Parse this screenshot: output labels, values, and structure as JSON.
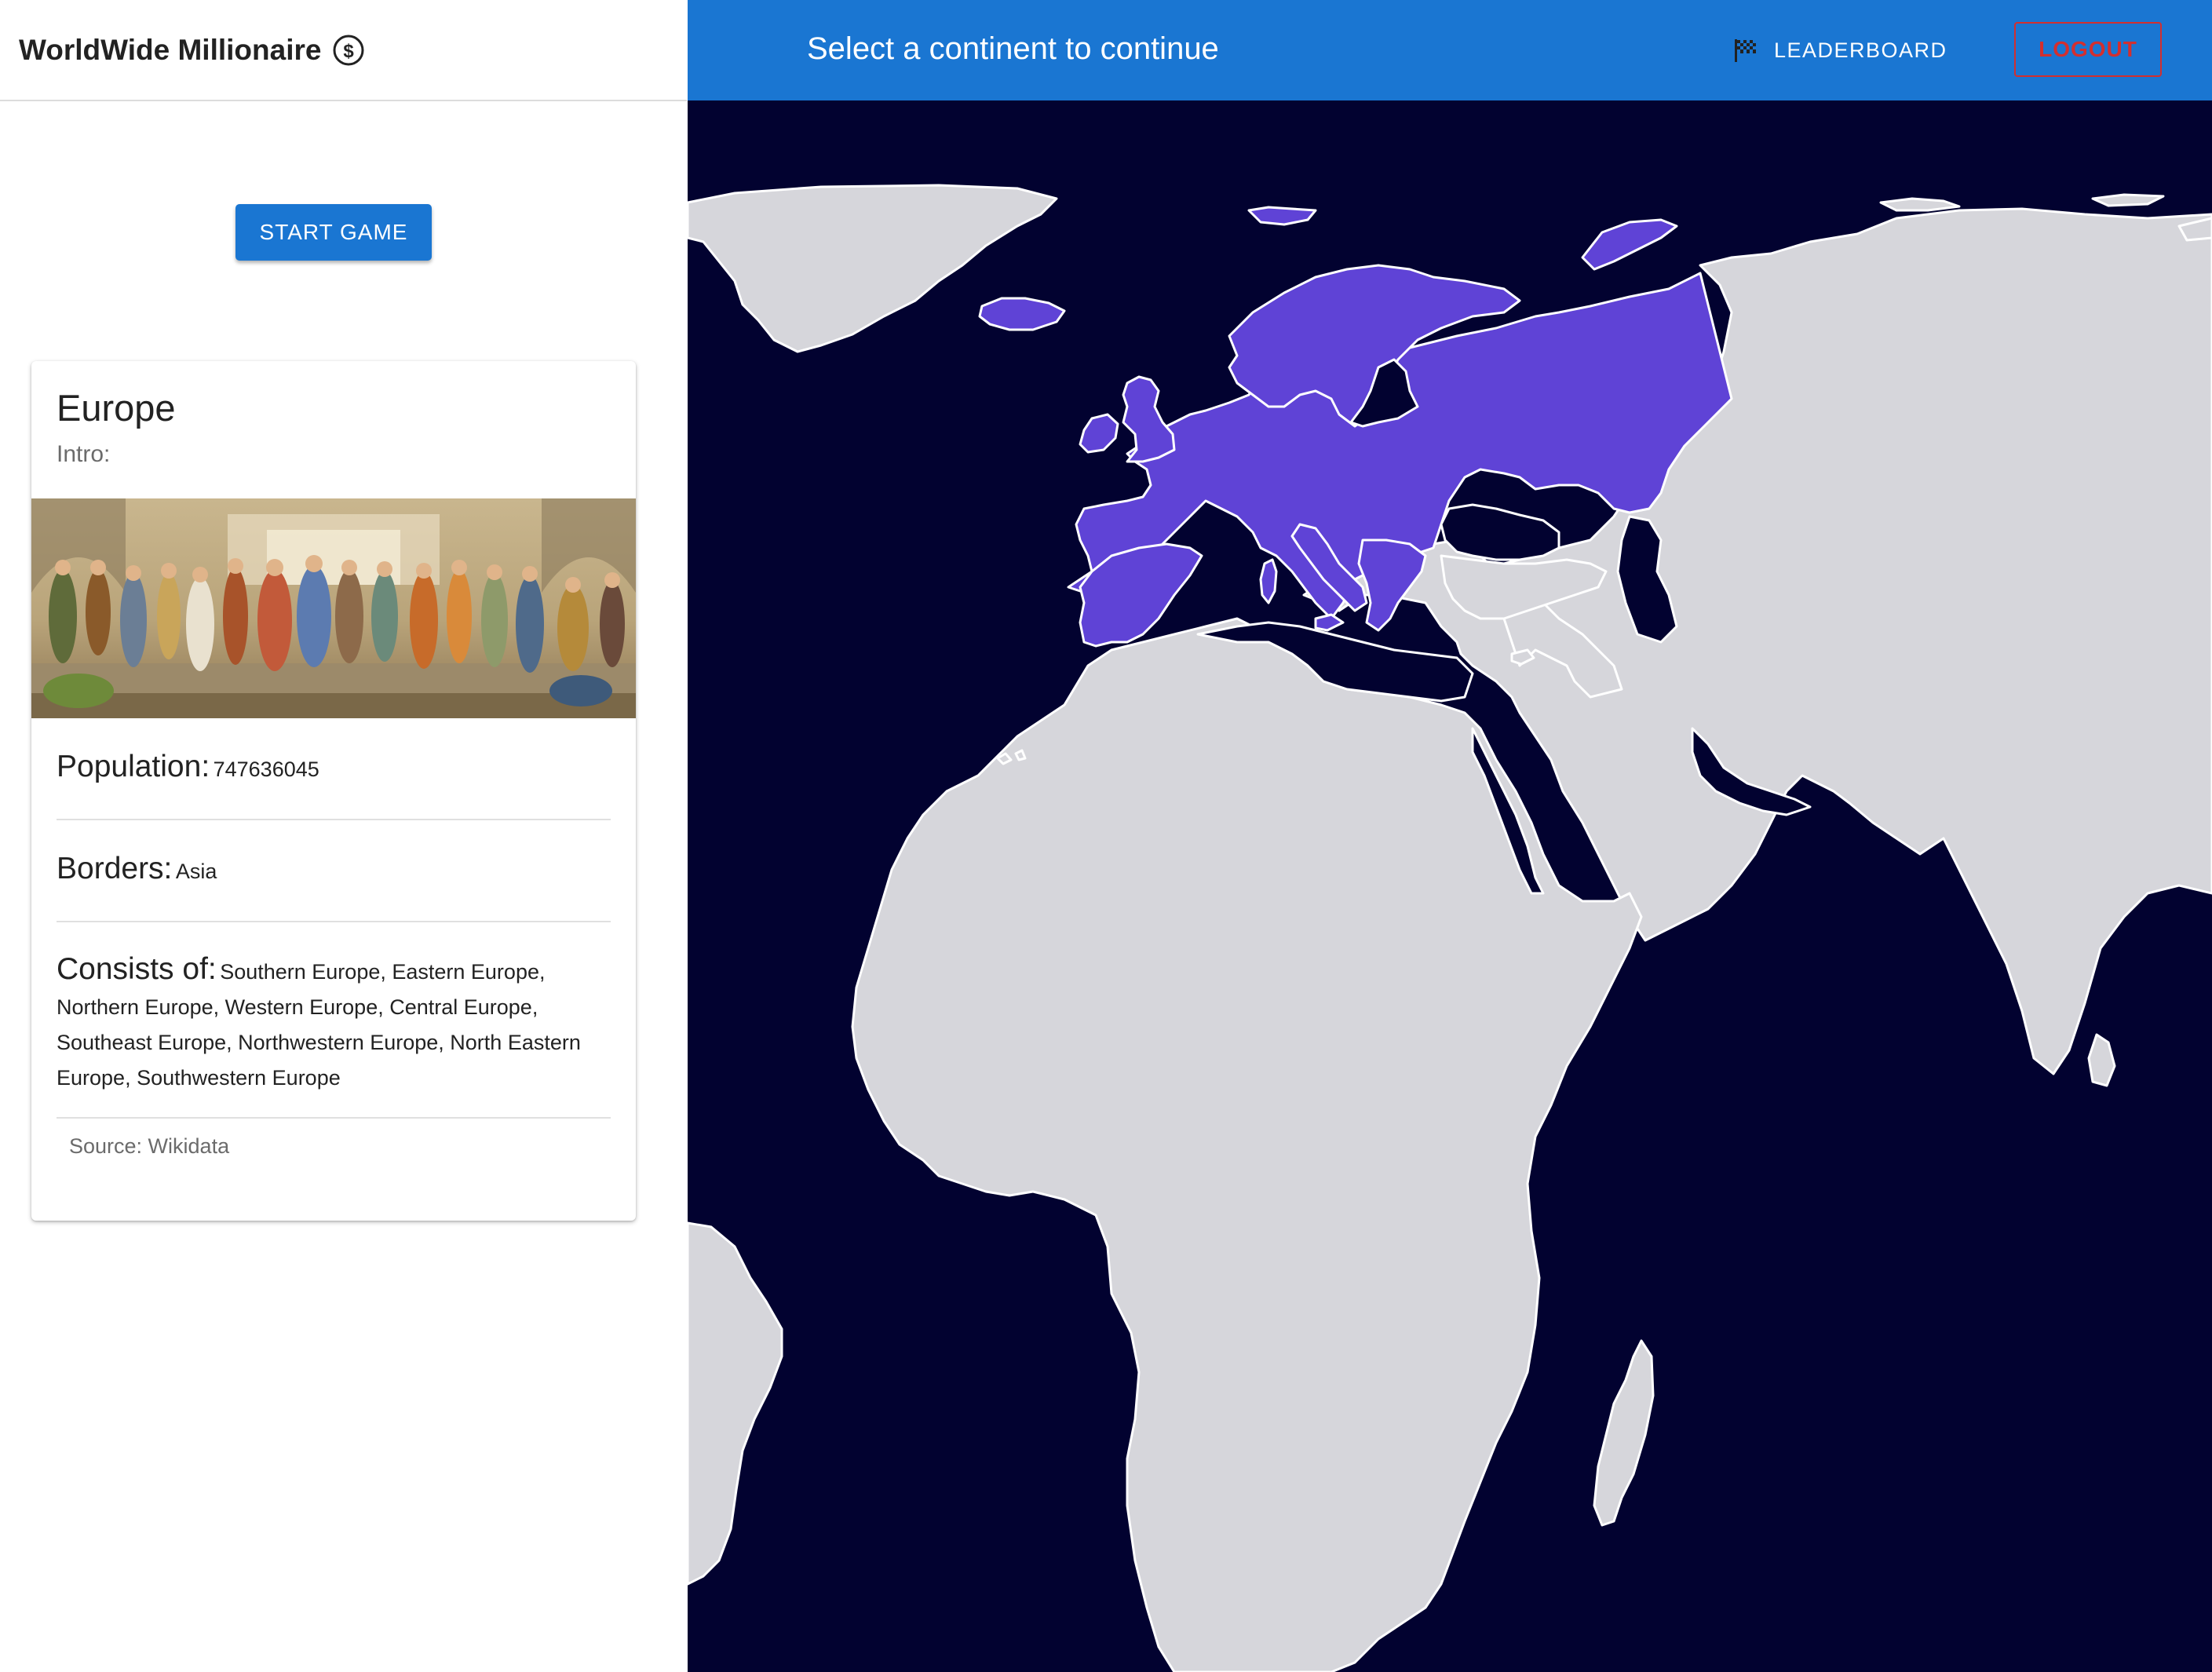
{
  "app": {
    "title": "WorldWide Millionaire",
    "title_icon": "dollar-circle-icon"
  },
  "left_panel": {
    "start_button_label": "START GAME"
  },
  "card": {
    "title": "Europe",
    "intro_label": "Intro:",
    "image_alt": "painting",
    "population_label": "Population:",
    "population_value": "747636045",
    "borders_label": "Borders:",
    "borders_value": "Asia",
    "consists_label": "Consists of:",
    "consists_value": "Southern Europe, Eastern Europe, Northern Europe, Western Europe, Central Europe, Southeast Europe, Northwestern Europe, North Eastern Europe, Southwestern Europe",
    "source": "Source: Wikidata"
  },
  "top_bar": {
    "title": "Select a continent to continue",
    "leaderboard_label": "LEADERBOARD",
    "leaderboard_icon": "checkered-flag-icon",
    "logout_label": "LOGOUT"
  },
  "map": {
    "selected_continent": "Europe",
    "colors": {
      "ocean": "#020230",
      "land": "#d6d6db",
      "selected": "#5f43d6",
      "border": "#ffffff"
    }
  },
  "colors": {
    "primary": "#1a76d2",
    "logout": "#d32f2f"
  }
}
